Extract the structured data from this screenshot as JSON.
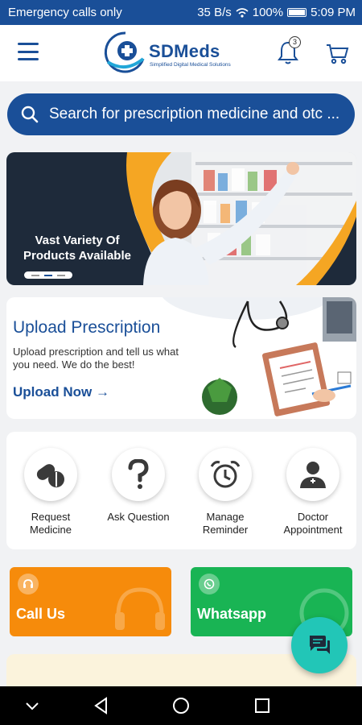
{
  "status_bar": {
    "carrier": "Emergency calls only",
    "speed": "35 B/s",
    "battery": "100%",
    "time": "5:09 PM"
  },
  "header": {
    "brand": "SDMeds",
    "tagline": "Simplified Digital Medical Solutions",
    "notification_count": "3"
  },
  "search": {
    "placeholder": "Search for prescription medicine and otc ..."
  },
  "banner": {
    "text": "Vast Variety Of Products Available",
    "colors": {
      "dark": "#1e2a3a",
      "accent": "#f5a623"
    }
  },
  "upload": {
    "title": "Upload Prescription",
    "description": "Upload prescription and tell us what you need. We do the best!",
    "link": "Upload Now"
  },
  "services": [
    {
      "label": "Request Medicine",
      "icon": "pills-icon"
    },
    {
      "label": "Ask Question",
      "icon": "question-icon"
    },
    {
      "label": "Manage Reminder",
      "icon": "alarm-clock-icon"
    },
    {
      "label": "Doctor Appointment",
      "icon": "doctor-icon"
    }
  ],
  "actions": {
    "call": "Call Us",
    "whatsapp": "Whatsapp"
  },
  "colors": {
    "primary": "#1a4f98",
    "orange": "#f68b0b",
    "green": "#19b454",
    "teal": "#22c6b7"
  }
}
